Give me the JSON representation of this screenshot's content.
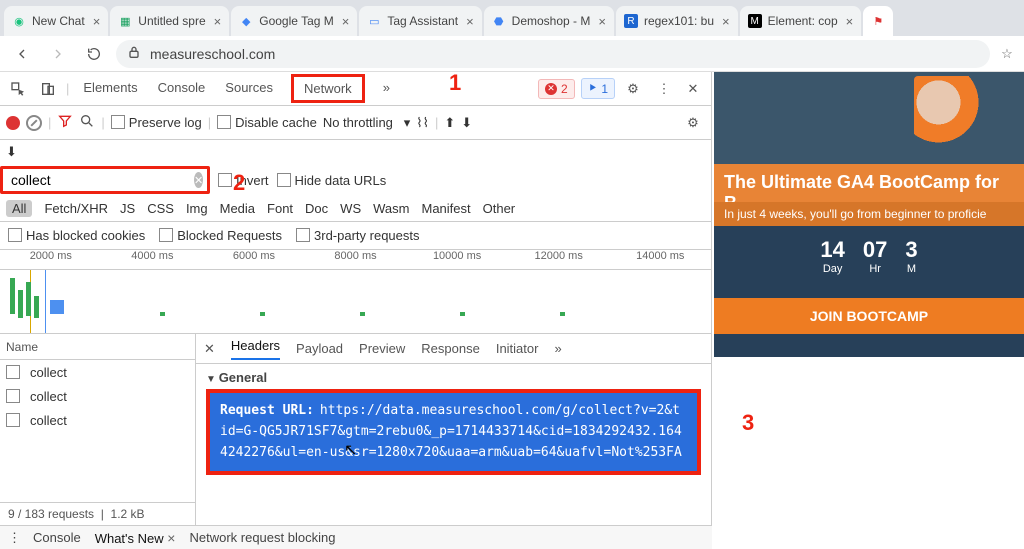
{
  "browser_tabs": [
    {
      "favicon": "◉",
      "color": "#19c37d",
      "label": "New Chat"
    },
    {
      "favicon": "▦",
      "color": "#0f9d58",
      "label": "Untitled spre"
    },
    {
      "favicon": "◆",
      "color": "#4285f4",
      "label": "Google Tag M"
    },
    {
      "favicon": "▭",
      "color": "#4285f4",
      "label": "Tag Assistant"
    },
    {
      "favicon": "⬣",
      "color": "#4285f4",
      "label": "Demoshop - M"
    },
    {
      "favicon": "R",
      "color": "#1e66d0",
      "label": "regex101: bu"
    },
    {
      "favicon": "M",
      "color": "#000",
      "label": "Element: cop"
    }
  ],
  "address_bar": {
    "url": "measureschool.com"
  },
  "devtools": {
    "tabs": [
      "Elements",
      "Console",
      "Sources",
      "Network"
    ],
    "more": "»",
    "errors_badge": "2",
    "info_badge": "1",
    "toolbar_row2": {
      "preserve_log": "Preserve log",
      "disable_cache": "Disable cache",
      "throttling": "No throttling"
    },
    "filter_value": "collect",
    "invert": "Invert",
    "hide_data_urls": "Hide data URLs",
    "type_filters": [
      "All",
      "Fetch/XHR",
      "JS",
      "CSS",
      "Img",
      "Media",
      "Font",
      "Doc",
      "WS",
      "Wasm",
      "Manifest",
      "Other"
    ],
    "selected_type": "All",
    "extra_filters": [
      "Has blocked cookies",
      "Blocked Requests",
      "3rd-party requests"
    ],
    "timeline_labels": [
      "2000 ms",
      "4000 ms",
      "6000 ms",
      "8000 ms",
      "10000 ms",
      "12000 ms",
      "14000 ms"
    ],
    "name_header": "Name",
    "requests": [
      "collect",
      "collect",
      "collect"
    ],
    "status": "9 / 183 requests",
    "size_status": "1.2 kB",
    "detail_tabs": [
      "Headers",
      "Payload",
      "Preview",
      "Response",
      "Initiator"
    ],
    "detail_more": "»",
    "general": "General",
    "request_url_label": "Request URL:",
    "request_url_value": "https://data.measureschool.com/g/collect?v=2&tid=G-QG5JR71SF7&gtm=2rebu0&_p=1714433714&cid=1834292432.1644242276&ul=en-us&sr=1280x720&uaa=arm&uab=64&uafvl=Not%253FA"
  },
  "drawer_tabs": [
    "Console",
    "What's New",
    "Network request blocking"
  ],
  "annotations": {
    "a1": "1",
    "a2": "2",
    "a3": "3"
  },
  "page": {
    "headline": "The Ultimate GA4 BootCamp for B",
    "sub": "In just 4 weeks, you'll go from beginner to proficie",
    "countdown": [
      {
        "big": "14",
        "lbl": "Day"
      },
      {
        "big": "07",
        "lbl": "Hr"
      },
      {
        "big": "3",
        "lbl": "M"
      }
    ],
    "cta": "JOIN BOOTCAMP"
  }
}
